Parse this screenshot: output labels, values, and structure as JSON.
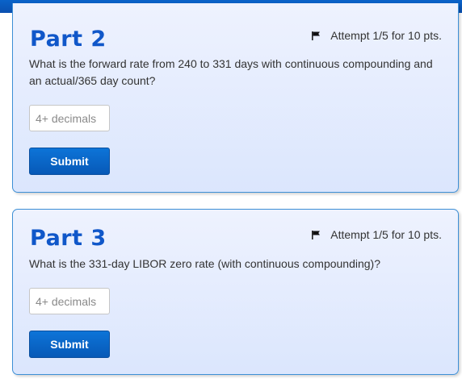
{
  "colors": {
    "accent": "#1057c9",
    "button": "#0a66c8",
    "card_bg": "#e3ebfd",
    "card_border": "#3d8fd6"
  },
  "parts": [
    {
      "title": "Part 2",
      "attempt": "Attempt 1/5 for 10 pts.",
      "question": "What is the forward rate from 240 to 331 days with continuous compounding and an actual/365 day count?",
      "input_placeholder": "4+ decimals",
      "input_value": "",
      "submit_label": "Submit",
      "icon": "flag-icon"
    },
    {
      "title": "Part 3",
      "attempt": "Attempt 1/5 for 10 pts.",
      "question": "What is the 331-day LIBOR zero rate (with continuous compounding)?",
      "input_placeholder": "4+ decimals",
      "input_value": "",
      "submit_label": "Submit",
      "icon": "flag-icon"
    }
  ]
}
